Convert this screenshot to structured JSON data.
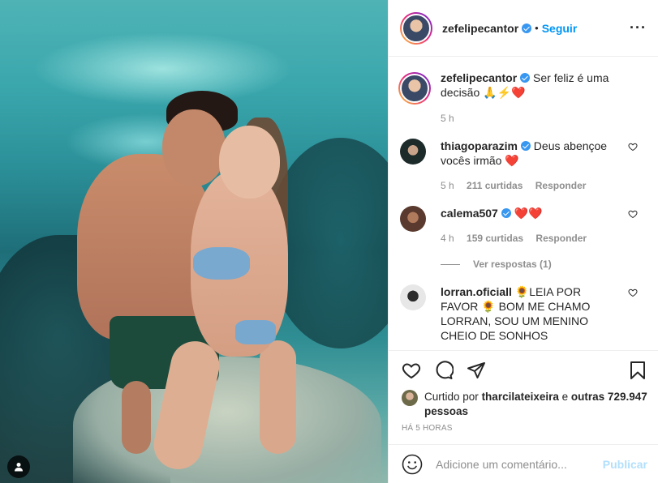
{
  "header": {
    "username": "zefelipecantor",
    "separator": "•",
    "follow_label": "Seguir",
    "more_label": "···"
  },
  "caption": {
    "username": "zefelipecantor",
    "text": "Ser feliz é uma decisão",
    "emoji": "🙏⚡❤️",
    "time": "5 h"
  },
  "comments": [
    {
      "username": "thiagoparazim",
      "text": "Deus abençoe vocês irmão",
      "emoji": "❤️",
      "time": "5 h",
      "likes": "211 curtidas",
      "reply": "Responder"
    },
    {
      "username": "calema507",
      "text": "",
      "emoji": "❤️❤️",
      "time": "4 h",
      "likes": "159 curtidas",
      "reply": "Responder",
      "view_replies": "Ver respostas (1)"
    },
    {
      "username": "lorran.oficiall",
      "text": "🌻LEIA POR FAVOR 🌻 BOM ME CHAMO LORRAN, SOU UM MENINO CHEIO DE SONHOS"
    }
  ],
  "liked_by": {
    "prefix": "Curtido por",
    "user": "tharcilateixeira",
    "conj": "e",
    "others": "outras 729.947 pessoas"
  },
  "post_time": "HÁ 5 HORAS",
  "comment_input": {
    "placeholder": "Adicione um comentário...",
    "publish_label": "Publicar"
  },
  "icons": [
    "heart-icon",
    "comment-icon",
    "share-icon",
    "save-icon",
    "emoji-icon",
    "tag-user-icon",
    "verified-icon"
  ],
  "colors": {
    "link": "#0095f6",
    "verified": "#3897f0",
    "muted": "#8e8e8e",
    "publish_disabled": "#b2dffc"
  }
}
